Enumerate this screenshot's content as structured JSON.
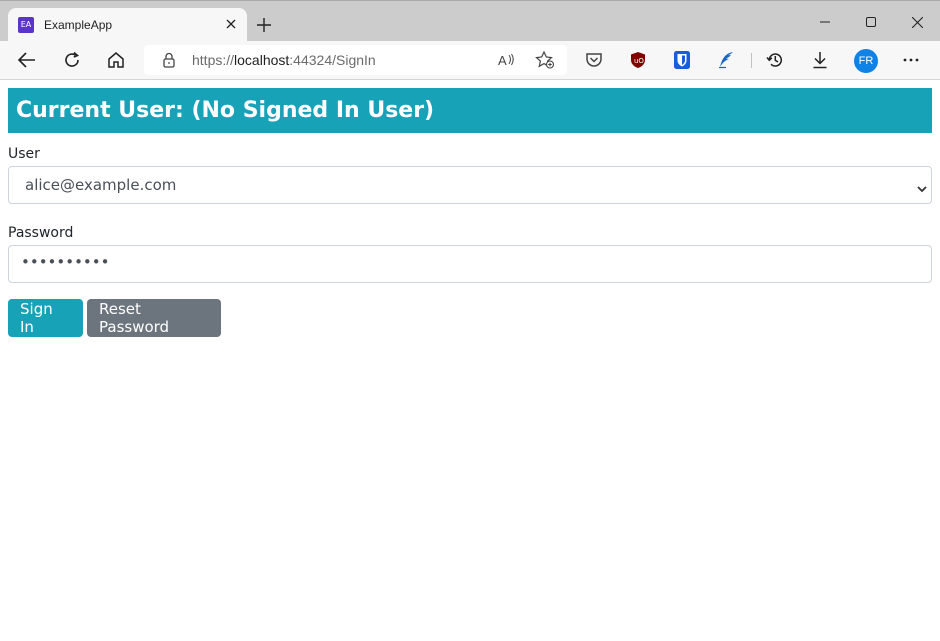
{
  "browser": {
    "tab_title": "ExampleApp",
    "favicon_text": "EA",
    "url_prefix": "https://",
    "url_host": "localhost",
    "url_rest": ":44324/SignIn",
    "profile_initials": "FR",
    "icons": {
      "back": "back-arrow-icon",
      "reload": "reload-icon",
      "home": "home-icon",
      "lock": "lock-icon",
      "read_aloud": "read-aloud-icon",
      "favorite": "add-favorite-icon",
      "pocket": "pocket-icon",
      "ublock": "ublock-icon",
      "bitwarden": "bitwarden-icon",
      "quill": "quill-icon",
      "history": "history-icon",
      "downloads": "download-icon",
      "more": "more-icon"
    },
    "colors": {
      "tabstrip": "#cccccc",
      "toolbar": "#f7f7f7",
      "avatar": "#0f82e6",
      "favicon": "#5b34c9"
    }
  },
  "page": {
    "banner": "Current User: (No Signed In User)",
    "user_label": "User",
    "user_value": "alice@example.com",
    "password_label": "Password",
    "password_value": "••••••••••",
    "sign_in_label": "Sign In",
    "reset_label": "Reset Password",
    "colors": {
      "primary": "#17a2b8",
      "secondary": "#6c757d"
    }
  }
}
